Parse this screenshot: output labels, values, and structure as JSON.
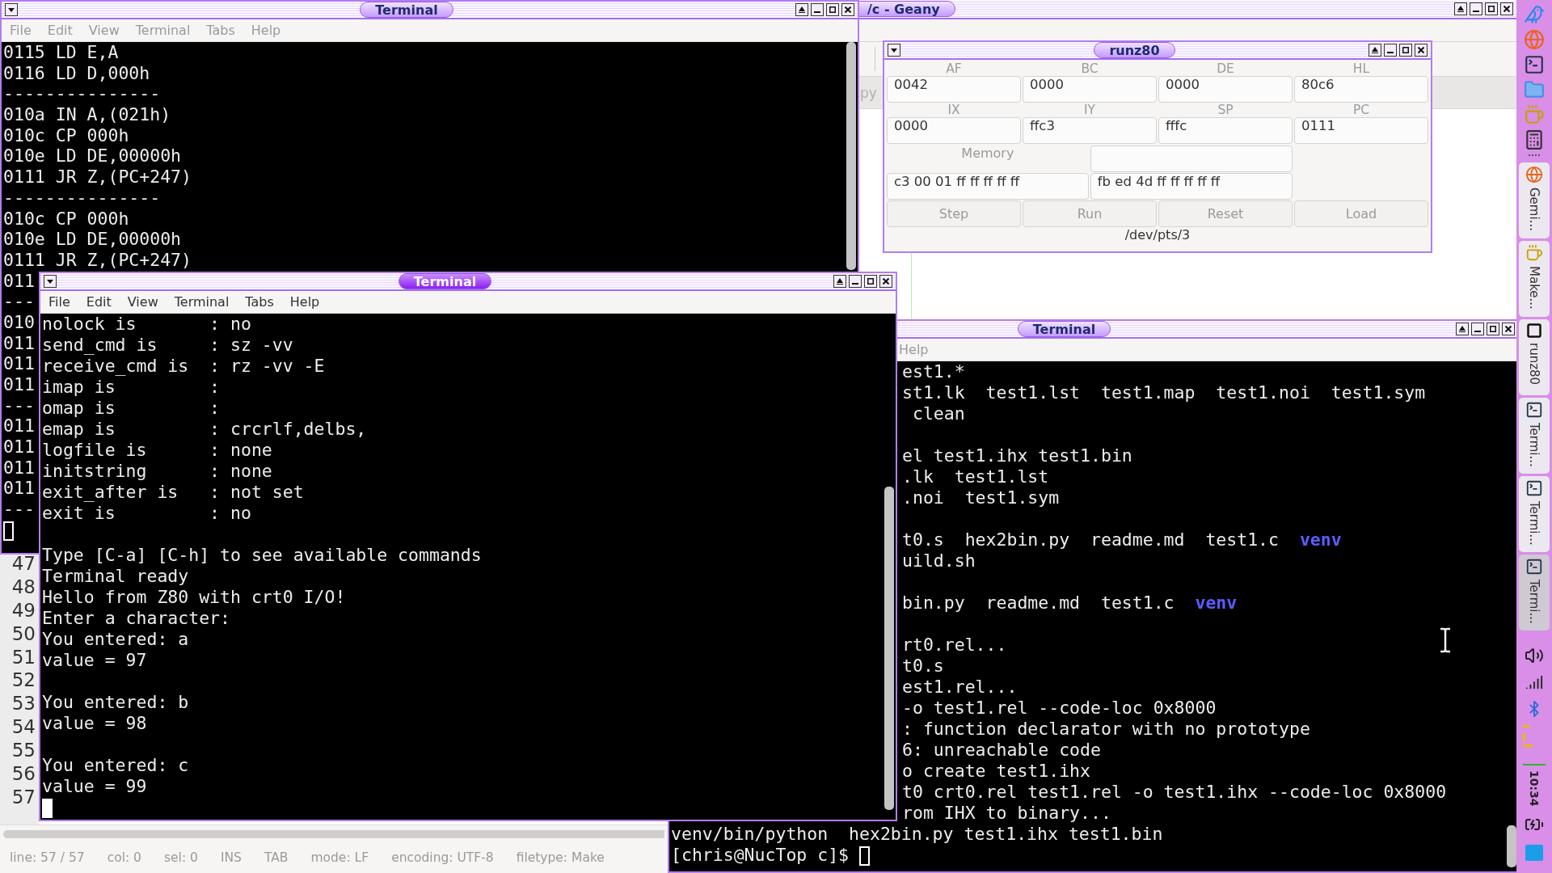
{
  "geany": {
    "title": "/c - Geany",
    "tab_fragment": "py",
    "line_numbers": [
      "47",
      "48",
      "49",
      "50",
      "51",
      "52",
      "53",
      "54",
      "55",
      "56",
      "57"
    ],
    "status_bar": [
      "line: 57 / 57",
      "col: 0",
      "sel: 0",
      "INS",
      "TAB",
      "mode: LF",
      "encoding: UTF-8",
      "filetype: Make"
    ]
  },
  "back_terminal": {
    "title": "Terminal",
    "active": false,
    "cursor_filled": false,
    "menu": [
      "File",
      "Edit",
      "View",
      "Terminal",
      "Tabs",
      "Help"
    ],
    "blocks": [
      [
        "0115 LD E,A",
        "0116 LD D,000h",
        "---------------",
        "010a IN A,(021h)",
        "010c CP 000h",
        "010e LD DE,00000h",
        "0111 JR Z,(PC+247)",
        "---------------",
        "010c CP 000h",
        "010e LD DE,00000h",
        "0111 JR Z,(PC+247)",
        "011",
        "---",
        "010",
        "011",
        "011",
        "011",
        "---",
        "011",
        "011",
        "011",
        "011",
        "---"
      ]
    ]
  },
  "runz80": {
    "title": "runz80",
    "registers": [
      {
        "label": "AF",
        "value": "0042"
      },
      {
        "label": "BC",
        "value": "0000"
      },
      {
        "label": "DE",
        "value": "0000"
      },
      {
        "label": "HL",
        "value": "80c6"
      },
      {
        "label": "IX",
        "value": "0000"
      },
      {
        "label": "IY",
        "value": "ffc3"
      },
      {
        "label": "SP",
        "value": "fffc"
      },
      {
        "label": "PC",
        "value": "0111"
      }
    ],
    "memory_label": "Memory",
    "memory": [
      "c3 00 01 ff ff ff ff ff",
      "fb ed 4d ff ff ff ff ff"
    ],
    "buttons": [
      "Step",
      "Run",
      "Reset",
      "Load"
    ],
    "device": "/dev/pts/3"
  },
  "side_terminal": {
    "title": "Terminal",
    "active": false,
    "cursor_filled": false,
    "menu": [
      "Help"
    ],
    "blocks": [
      [
        {
          "kind": "clipped",
          "text": "est1.*"
        },
        {
          "kind": "clipped",
          "text": "st1.lk  test1.lst  test1.map  test1.noi  test1.sym"
        },
        {
          "kind": "clipped",
          "text": " clean"
        }
      ],
      [
        {
          "kind": "clipped",
          "text": "el test1.ihx test1.bin"
        },
        {
          "kind": "clipped",
          "text": ".lk  test1.lst"
        },
        {
          "kind": "clipped",
          "text": ".noi  test1.sym"
        }
      ],
      [
        {
          "kind": "clipped",
          "text": "t0.s  hex2bin.py  readme.md  test1.c  ",
          "dir": "venv"
        },
        {
          "kind": "clipped",
          "text": "uild.sh"
        }
      ],
      [
        {
          "kind": "clipped",
          "text": "bin.py  readme.md  test1.c  ",
          "dir": "venv"
        }
      ],
      [
        {
          "kind": "clipped",
          "text": "rt0.rel..."
        },
        {
          "kind": "clipped",
          "text": "t0.s"
        },
        {
          "kind": "clipped",
          "text": "est1.rel..."
        },
        {
          "kind": "clipped",
          "text": "-o test1.rel --code-loc 0x8000"
        },
        {
          "kind": "clipped",
          "text": ": function declarator with no prototype"
        },
        {
          "kind": "clipped",
          "text": "6: unreachable code"
        },
        {
          "kind": "clipped",
          "text": "o create test1.ihx"
        },
        {
          "kind": "clipped",
          "text": "t0 crt0.rel test1.rel -o test1.ihx --code-loc 0x8000"
        },
        {
          "kind": "clipped",
          "text": "rom IHX to binary..."
        },
        {
          "kind": "full",
          "text": "venv/bin/python  hex2bin.py test1.ihx test1.bin"
        },
        {
          "kind": "full",
          "text": "[chris@NucTop c]$ "
        }
      ]
    ]
  },
  "front_terminal": {
    "title": "Terminal",
    "active": true,
    "cursor_filled": true,
    "menu": [
      "File",
      "Edit",
      "View",
      "Terminal",
      "Tabs",
      "Help"
    ],
    "blocks": [
      [
        "nolock is       : no",
        "send_cmd is     : sz -vv",
        "receive_cmd is  : rz -vv -E",
        "imap is         :",
        "omap is         :",
        "emap is         : crcrlf,delbs,",
        "logfile is      : none",
        "initstring      : none",
        "exit_after is   : not set",
        "exit is         : no"
      ],
      [
        "Type [C-a] [C-h] to see available commands",
        "Terminal ready",
        "Hello from Z80 with crt0 I/O!",
        "Enter a character:",
        "You entered: a",
        "value = 97"
      ],
      [
        "You entered: b",
        "value = 98"
      ],
      [
        "You entered: c",
        "value = 99"
      ]
    ]
  },
  "taskbar": {
    "tasks": [
      {
        "kind": "browser",
        "label": "Gemi...",
        "selected": false
      },
      {
        "kind": "teapot",
        "label": "Make...",
        "selected": false
      },
      {
        "kind": "app",
        "label": "runz80",
        "selected": false
      },
      {
        "kind": "terminal",
        "label": "Termi...",
        "selected": false
      },
      {
        "kind": "terminal",
        "label": "Termi...",
        "selected": false
      },
      {
        "kind": "terminal",
        "label": "Termi...",
        "selected": true
      }
    ],
    "clock": "10:34"
  }
}
